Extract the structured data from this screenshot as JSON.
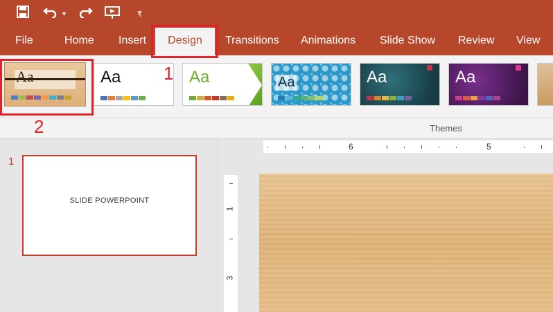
{
  "quick_access": {
    "save_icon": "save-icon",
    "undo_icon": "undo-icon",
    "redo_icon": "redo-icon",
    "present_icon": "present-from-start-icon",
    "customize_icon": "customize-quick-access-icon"
  },
  "tabs": {
    "file": "File",
    "home": "Home",
    "insert": "Insert",
    "design": "Design",
    "transitions": "Transitions",
    "animations": "Animations",
    "slideshow": "Slide Show",
    "review": "Review",
    "view": "View",
    "active": "Design"
  },
  "themes": {
    "group_label": "Themes",
    "sample_text": "Aa",
    "items": [
      {
        "name": "wood",
        "swatches": [
          "#4f81bd",
          "#9bbb59",
          "#c0504d",
          "#8064a2",
          "#f79646",
          "#4bacc6",
          "#7f7f7f",
          "#c9a227"
        ]
      },
      {
        "name": "office",
        "swatches": [
          "#4472c4",
          "#ed7d31",
          "#a5a5a5",
          "#ffc000",
          "#5b9bd5",
          "#70ad47"
        ]
      },
      {
        "name": "green",
        "swatches": [
          "#6fae2c",
          "#d0ab3f",
          "#d9541e",
          "#c0392b",
          "#8a6e4b",
          "#f2a900"
        ]
      },
      {
        "name": "pattern",
        "swatches": [
          "#1f7fb8",
          "#5ab4d7",
          "#2ea89a",
          "#59b36f",
          "#85c26b",
          "#b8d35f"
        ]
      },
      {
        "name": "teal",
        "swatches": [
          "#c0334b",
          "#d9822b",
          "#e6b93c",
          "#8bb140",
          "#3e9bc4",
          "#7a5ea8"
        ]
      },
      {
        "name": "purple",
        "swatches": [
          "#d33c8e",
          "#e05b3d",
          "#f0a33a",
          "#7f3aa5",
          "#4c6bc5",
          "#b0418f"
        ]
      }
    ]
  },
  "annotations": {
    "step1": "1",
    "step2": "2"
  },
  "slides": {
    "number": "1",
    "title": "SLIDE POWERPOINT"
  },
  "ruler": {
    "h_label_a": "6",
    "h_label_b": "5",
    "v_label_a": "1",
    "v_label_b": "3"
  },
  "colors": {
    "accent": "#b7472a",
    "annotation": "#e0222a"
  }
}
